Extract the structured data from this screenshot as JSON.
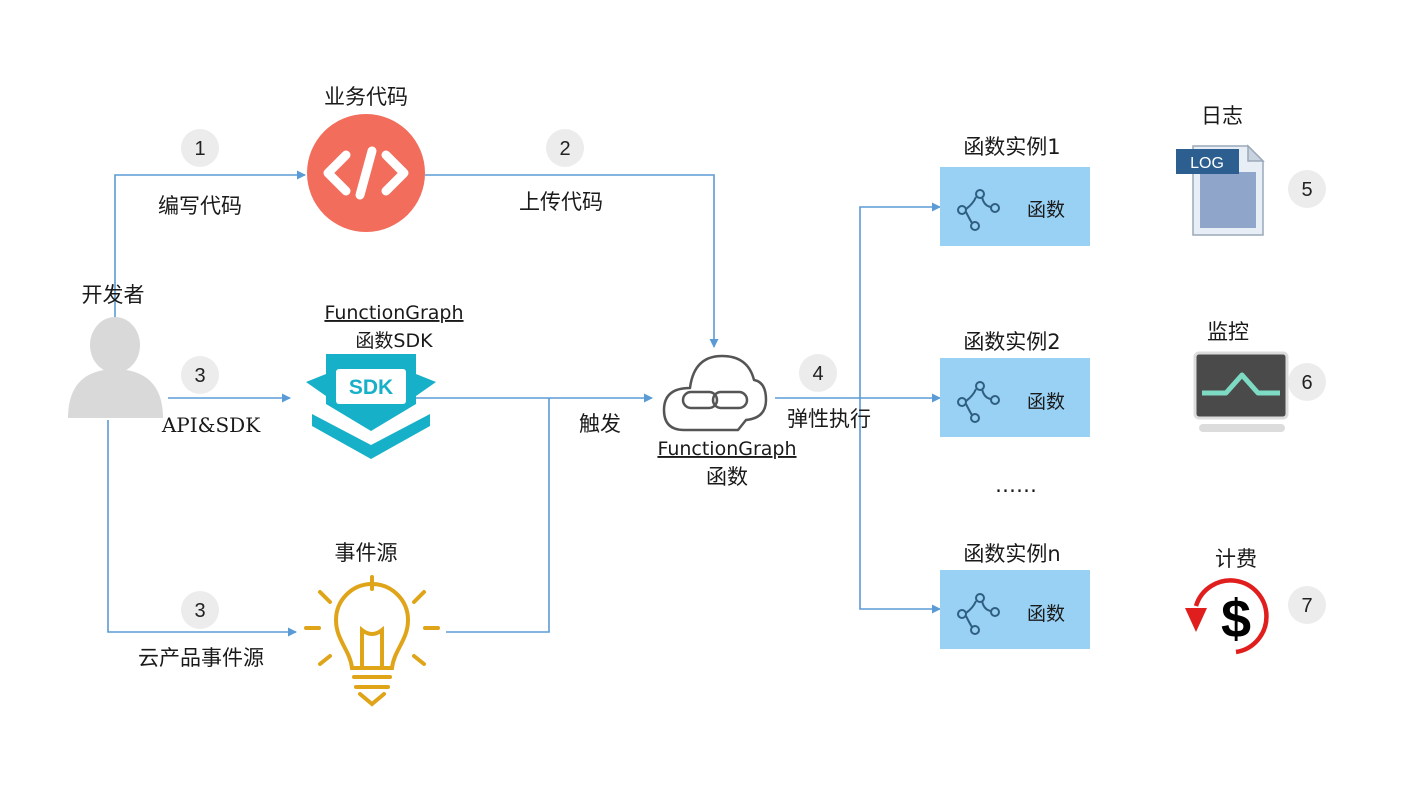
{
  "developer": {
    "label": "开发者"
  },
  "business_code": {
    "label": "业务代码"
  },
  "sdk": {
    "title": "FunctionGraph",
    "subtitle": "函数SDK",
    "badge": "SDK"
  },
  "event_source": {
    "label": "事件源"
  },
  "function": {
    "title": "FunctionGraph",
    "subtitle": "函数"
  },
  "steps": {
    "write": {
      "num": "1",
      "label": "编写代码"
    },
    "upload": {
      "num": "2",
      "label": "上传代码"
    },
    "api": {
      "num": "3",
      "label": "API&SDK"
    },
    "cloud": {
      "num": "3",
      "label": "云产品事件源"
    },
    "trigger": {
      "label": "触发"
    },
    "scale": {
      "num": "4",
      "label": "弹性执行"
    }
  },
  "instances": [
    {
      "title": "函数实例1",
      "box_label": "函数"
    },
    {
      "title": "函数实例2",
      "box_label": "函数"
    },
    {
      "title": "函数实例n",
      "box_label": "函数"
    }
  ],
  "ellipsis": "……",
  "services": {
    "log": {
      "title": "日志",
      "num": "5",
      "badge": "LOG"
    },
    "monitor": {
      "title": "监控",
      "num": "6"
    },
    "billing": {
      "title": "计费",
      "num": "7"
    }
  },
  "colors": {
    "connector": "#5b9bd5",
    "code_icon": "#f26d5b",
    "sdk_icon": "#17b0c9",
    "bulb_icon": "#e0a419",
    "instance_box": "#99d1f5",
    "step_circle": "#ececec"
  }
}
